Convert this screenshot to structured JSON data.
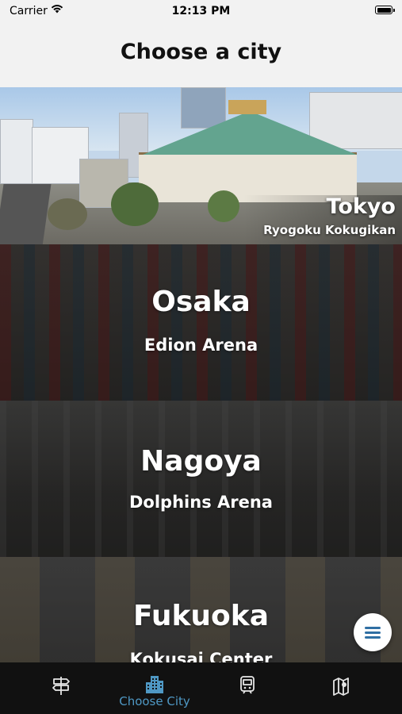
{
  "status_bar": {
    "carrier": "Carrier",
    "time": "12:13 PM"
  },
  "header": {
    "title": "Choose a city"
  },
  "cities": [
    {
      "name": "Tokyo",
      "venue": "Ryogoku Kokugikan"
    },
    {
      "name": "Osaka",
      "venue": "Edion Arena"
    },
    {
      "name": "Nagoya",
      "venue": "Dolphins Arena"
    },
    {
      "name": "Fukuoka",
      "venue": "Kokusai Center"
    }
  ],
  "tab_bar": {
    "active_index": 1,
    "active_color": "#4f98c4",
    "tabs": [
      {
        "icon": "signpost-icon",
        "label": ""
      },
      {
        "icon": "city-buildings-icon",
        "label": "Choose City"
      },
      {
        "icon": "train-icon",
        "label": ""
      },
      {
        "icon": "map-pin-icon",
        "label": ""
      }
    ]
  },
  "fab": {
    "icon": "menu-icon"
  }
}
